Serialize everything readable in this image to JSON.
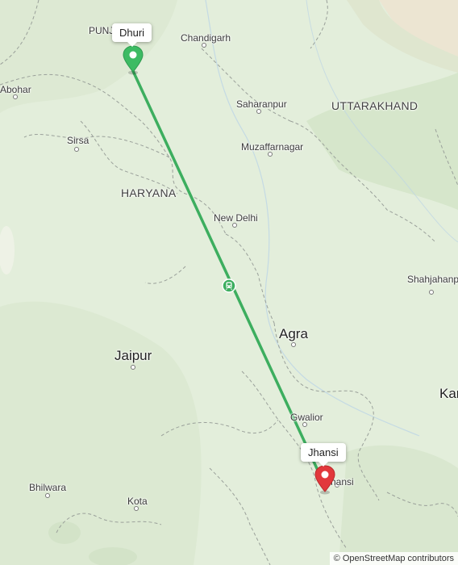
{
  "map": {
    "places": {
      "punjab": "PUNJAB",
      "chandigarh": "Chandigarh",
      "abohar": "Abohar",
      "sirsa": "Sirsa",
      "haryana": "HARYANA",
      "saharanpur": "Saharanpur",
      "uttarakhand": "UTTARAKHAND",
      "muzaffarnagar": "Muzaffarnagar",
      "new_delhi": "New Delhi",
      "shahjahanpur": "Shahjahanpur",
      "agra": "Agra",
      "jaipur": "Jaipur",
      "kanpur": "Kanpur",
      "gwalior": "Gwalior",
      "jhansi_city": "Jhansi",
      "bhilwara": "Bhilwara",
      "kota": "Kota"
    },
    "route": {
      "origin_label": "Dhuri",
      "destination_label": "Jhansi",
      "transport_icon": "train-icon",
      "route_color": "#3dae5f",
      "origin_color": "#3dbb63",
      "destination_color": "#e2383c"
    },
    "attribution": "© OpenStreetMap contributors"
  }
}
